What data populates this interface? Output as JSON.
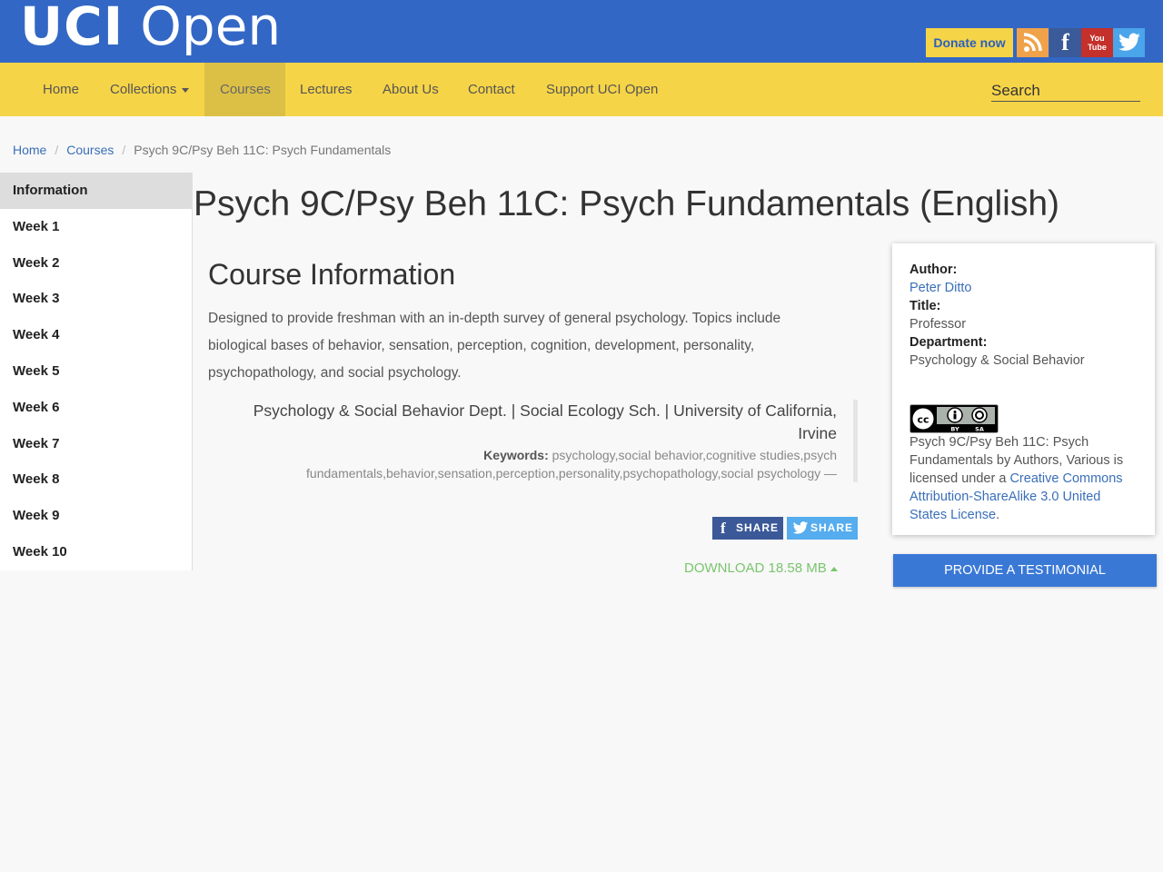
{
  "header": {
    "logo_bold": "UCI",
    "logo_light": "Open",
    "donate_label": "Donate now",
    "social": [
      {
        "icon": "rss-icon",
        "color": "#f0a24a"
      },
      {
        "icon": "facebook-icon",
        "color": "#3a5a99",
        "glyph": "f"
      },
      {
        "icon": "youtube-icon",
        "color": "#c4302b",
        "glyph": "You Tube"
      },
      {
        "icon": "twitter-icon",
        "color": "#4aa5ea"
      }
    ],
    "colors": {
      "brand_blue": "#3367c5",
      "brand_yellow": "#f6d447"
    }
  },
  "nav": {
    "items": [
      {
        "label": "Home"
      },
      {
        "label": "Collections"
      },
      {
        "label": "Courses"
      },
      {
        "label": "Lectures"
      },
      {
        "label": "About Us"
      },
      {
        "label": "Contact"
      },
      {
        "label": "Support UCI Open"
      }
    ],
    "search_placeholder": "Search"
  },
  "breadcrumb": {
    "home": "Home",
    "courses": "Courses",
    "current": "Psych 9C/Psy Beh 11C: Psych Fundamentals"
  },
  "sidebar": {
    "items": [
      {
        "label": "Information"
      },
      {
        "label": "Week 1"
      },
      {
        "label": "Week 2"
      },
      {
        "label": "Week 3"
      },
      {
        "label": "Week 4"
      },
      {
        "label": "Week 5"
      },
      {
        "label": "Week 6"
      },
      {
        "label": "Week 7"
      },
      {
        "label": "Week 8"
      },
      {
        "label": "Week 9"
      },
      {
        "label": "Week 10"
      }
    ]
  },
  "main": {
    "title": "Psych 9C/Psy Beh 11C: Psych Fundamentals (English)",
    "section_title": "Course Information",
    "description": "Designed to provide freshman with an in-depth survey of general psychology. Topics include biological bases of behavior, sensation, perception, cognition, development, personality, psychopathology, and social psychology.",
    "department_line": "Psychology & Social Behavior Dept. | Social Ecology Sch. | University of California, Irvine",
    "keywords_label": "Keywords:",
    "keywords": "psychology,social behavior,cognitive studies,psych fundamentals,behavior,sensation,perception,personality,psychopathology,social psychology —",
    "share_facebook": "SHARE",
    "share_twitter": "SHARE",
    "download_label": "DOWNLOAD 18.58 MB"
  },
  "card": {
    "author_label": "Author:",
    "author": "Peter Ditto",
    "title_label": "Title:",
    "title": "Professor",
    "department_label": "Department:",
    "department": "Psychology & Social Behavior",
    "license_prefix": "Psych 9C/Psy Beh 11C: Psych Fundamentals by Authors, Various is licensed under a",
    "license_link": "Creative Commons Attribution-ShareAlike 3.0 United States License",
    "license_suffix": ".",
    "cc_badge": [
      "cc",
      "BY",
      "SA"
    ]
  },
  "testimonial_label": "PROVIDE A TESTIMONIAL"
}
